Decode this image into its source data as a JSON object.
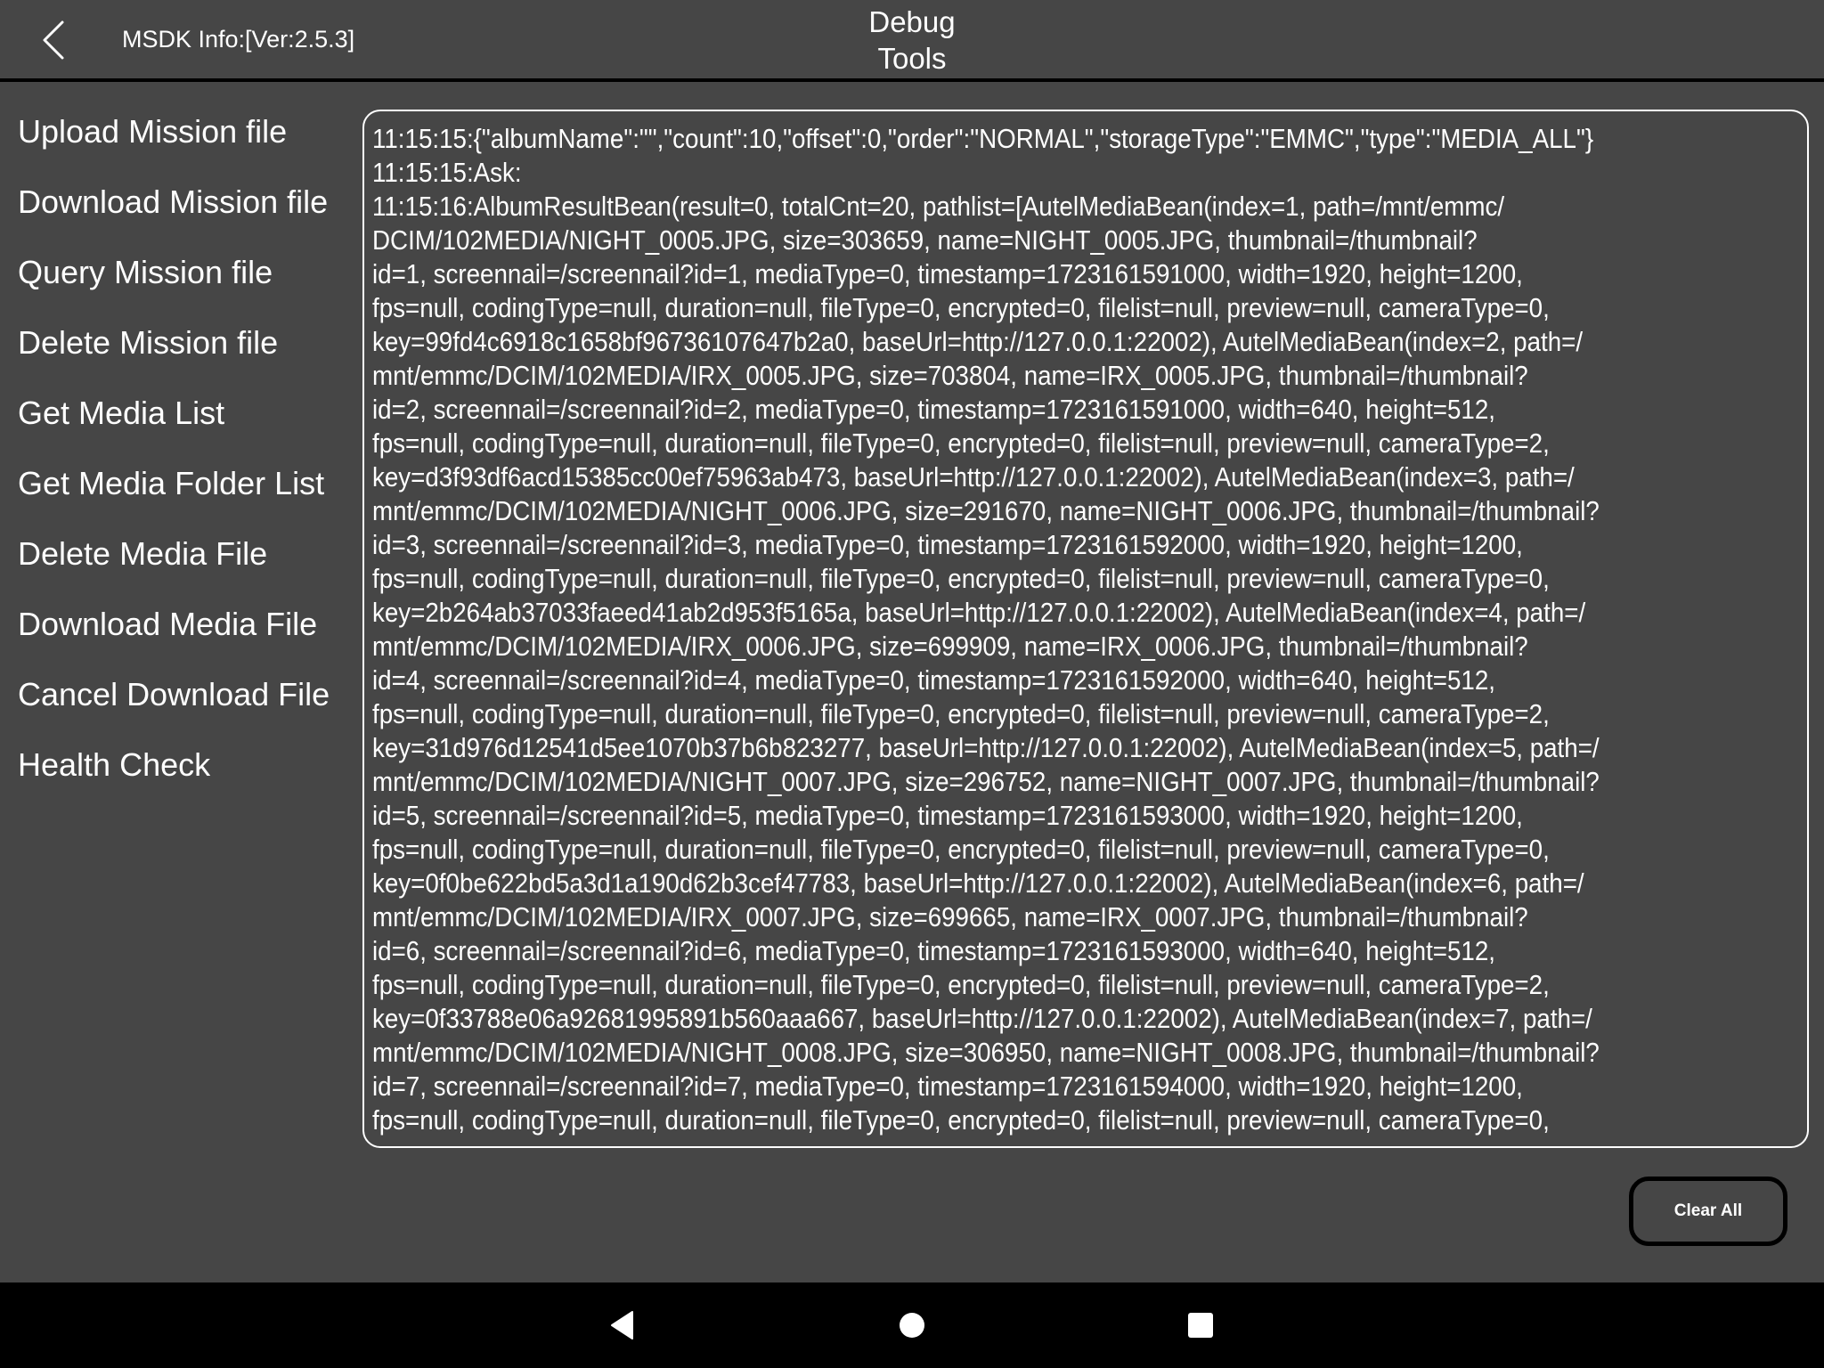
{
  "header": {
    "back_icon": "chevron-left",
    "sdk_info": "MSDK Info:[Ver:2.5.3]",
    "title_line1": "Debug",
    "title_line2": "Tools"
  },
  "menu": {
    "items": [
      {
        "label": "Upload Mission file"
      },
      {
        "label": "Download Mission file"
      },
      {
        "label": "Query Mission file"
      },
      {
        "label": "Delete Mission file"
      },
      {
        "label": "Get Media List"
      },
      {
        "label": "Get Media Folder List"
      },
      {
        "label": "Delete Media File"
      },
      {
        "label": "Download Media File"
      },
      {
        "label": "Cancel Download File"
      },
      {
        "label": "Health Check"
      }
    ]
  },
  "log": {
    "lines": [
      "11:15:15:{\"albumName\":\"\",\"count\":10,\"offset\":0,\"order\":\"NORMAL\",\"storageType\":\"EMMC\",\"type\":\"MEDIA_ALL\"}",
      "11:15:15:Ask:",
      "11:15:16:AlbumResultBean(result=0, totalCnt=20, pathlist=[AutelMediaBean(index=1, path=/mnt/emmc/",
      "DCIM/102MEDIA/NIGHT_0005.JPG, size=303659, name=NIGHT_0005.JPG, thumbnail=/thumbnail?",
      "id=1, screennail=/screennail?id=1, mediaType=0, timestamp=1723161591000, width=1920, height=1200,",
      "fps=null, codingType=null, duration=null, fileType=0, encrypted=0, filelist=null, preview=null, cameraType=0,",
      "key=99fd4c6918c1658bf96736107647b2a0, baseUrl=http://127.0.0.1:22002), AutelMediaBean(index=2, path=/",
      "mnt/emmc/DCIM/102MEDIA/IRX_0005.JPG, size=703804, name=IRX_0005.JPG, thumbnail=/thumbnail?",
      "id=2, screennail=/screennail?id=2, mediaType=0, timestamp=1723161591000, width=640, height=512,",
      "fps=null, codingType=null, duration=null, fileType=0, encrypted=0, filelist=null, preview=null, cameraType=2,",
      "key=d3f93df6acd15385cc00ef75963ab473, baseUrl=http://127.0.0.1:22002), AutelMediaBean(index=3, path=/",
      "mnt/emmc/DCIM/102MEDIA/NIGHT_0006.JPG, size=291670, name=NIGHT_0006.JPG, thumbnail=/thumbnail?",
      "id=3, screennail=/screennail?id=3, mediaType=0, timestamp=1723161592000, width=1920, height=1200,",
      "fps=null, codingType=null, duration=null, fileType=0, encrypted=0, filelist=null, preview=null, cameraType=0,",
      "key=2b264ab37033faeed41ab2d953f5165a, baseUrl=http://127.0.0.1:22002), AutelMediaBean(index=4, path=/",
      "mnt/emmc/DCIM/102MEDIA/IRX_0006.JPG, size=699909, name=IRX_0006.JPG, thumbnail=/thumbnail?",
      "id=4, screennail=/screennail?id=4, mediaType=0, timestamp=1723161592000, width=640, height=512,",
      "fps=null, codingType=null, duration=null, fileType=0, encrypted=0, filelist=null, preview=null, cameraType=2,",
      "key=31d976d12541d5ee1070b37b6b823277, baseUrl=http://127.0.0.1:22002), AutelMediaBean(index=5, path=/",
      "mnt/emmc/DCIM/102MEDIA/NIGHT_0007.JPG, size=296752, name=NIGHT_0007.JPG, thumbnail=/thumbnail?",
      "id=5, screennail=/screennail?id=5, mediaType=0, timestamp=1723161593000, width=1920, height=1200,",
      "fps=null, codingType=null, duration=null, fileType=0, encrypted=0, filelist=null, preview=null, cameraType=0,",
      "key=0f0be622bd5a3d1a190d62b3cef47783, baseUrl=http://127.0.0.1:22002), AutelMediaBean(index=6, path=/",
      "mnt/emmc/DCIM/102MEDIA/IRX_0007.JPG, size=699665, name=IRX_0007.JPG, thumbnail=/thumbnail?",
      "id=6, screennail=/screennail?id=6, mediaType=0, timestamp=1723161593000, width=640, height=512,",
      "fps=null, codingType=null, duration=null, fileType=0, encrypted=0, filelist=null, preview=null, cameraType=2,",
      "key=0f33788e06a92681995891b560aaa667, baseUrl=http://127.0.0.1:22002), AutelMediaBean(index=7, path=/",
      "mnt/emmc/DCIM/102MEDIA/NIGHT_0008.JPG, size=306950, name=NIGHT_0008.JPG, thumbnail=/thumbnail?",
      "id=7, screennail=/screennail?id=7, mediaType=0, timestamp=1723161594000, width=1920, height=1200,",
      "fps=null, codingType=null, duration=null, fileType=0, encrypted=0, filelist=null, preview=null, cameraType=0,"
    ]
  },
  "actions": {
    "clear_all_label": "Clear All"
  },
  "navbar": {
    "back_icon": "triangle-back",
    "home_icon": "circle-home",
    "recents_icon": "square-recents"
  },
  "colors": {
    "background": "#464646",
    "text": "#ffffff",
    "divider": "#000000",
    "navbar": "#000000"
  }
}
